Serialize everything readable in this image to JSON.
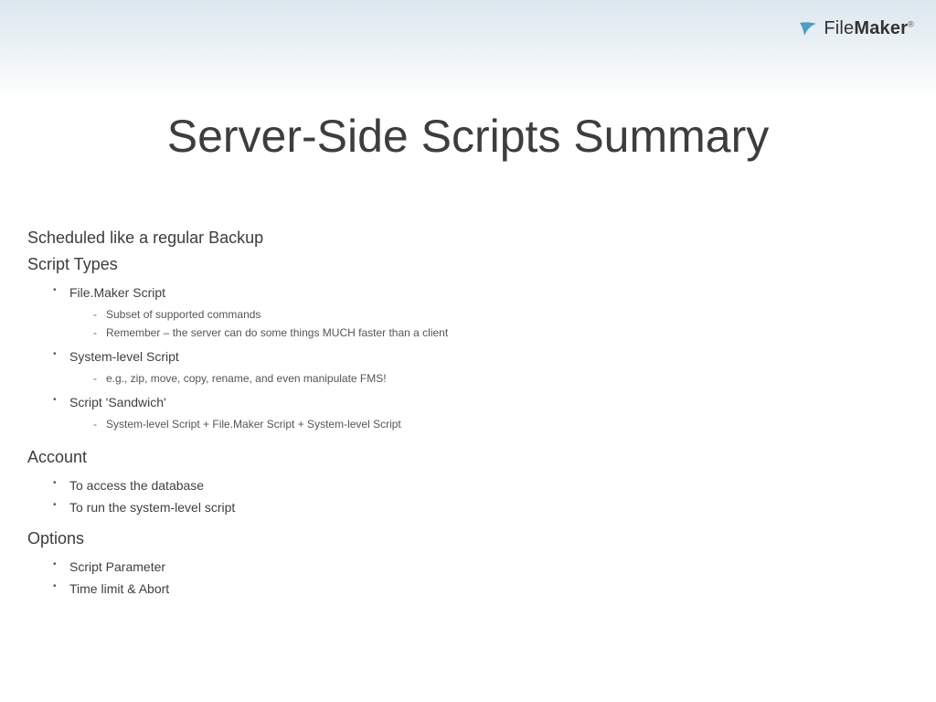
{
  "brand": {
    "prefix": "File",
    "suffix": "Maker"
  },
  "title": "Server-Side Scripts Summary",
  "sections": [
    {
      "heading": "Scheduled like a regular Backup",
      "items": []
    },
    {
      "heading": "Script Types",
      "items": [
        {
          "label": "File.Maker Script",
          "sub": [
            "Subset of supported commands",
            "Remember – the server can do some things MUCH faster than a client"
          ]
        },
        {
          "label": "System-level Script",
          "sub": [
            "e.g., zip, move, copy, rename, and even manipulate FMS!"
          ]
        },
        {
          "label": "Script 'Sandwich'",
          "sub": [
            "System-level Script + File.Maker Script + System-level Script"
          ]
        }
      ]
    },
    {
      "heading": "Account",
      "items": [
        {
          "label": "To access the database",
          "sub": []
        },
        {
          "label": "To run the system-level script",
          "sub": []
        }
      ]
    },
    {
      "heading": "Options",
      "items": [
        {
          "label": "Script Parameter",
          "sub": []
        },
        {
          "label": "Time limit & Abort",
          "sub": []
        }
      ]
    }
  ]
}
